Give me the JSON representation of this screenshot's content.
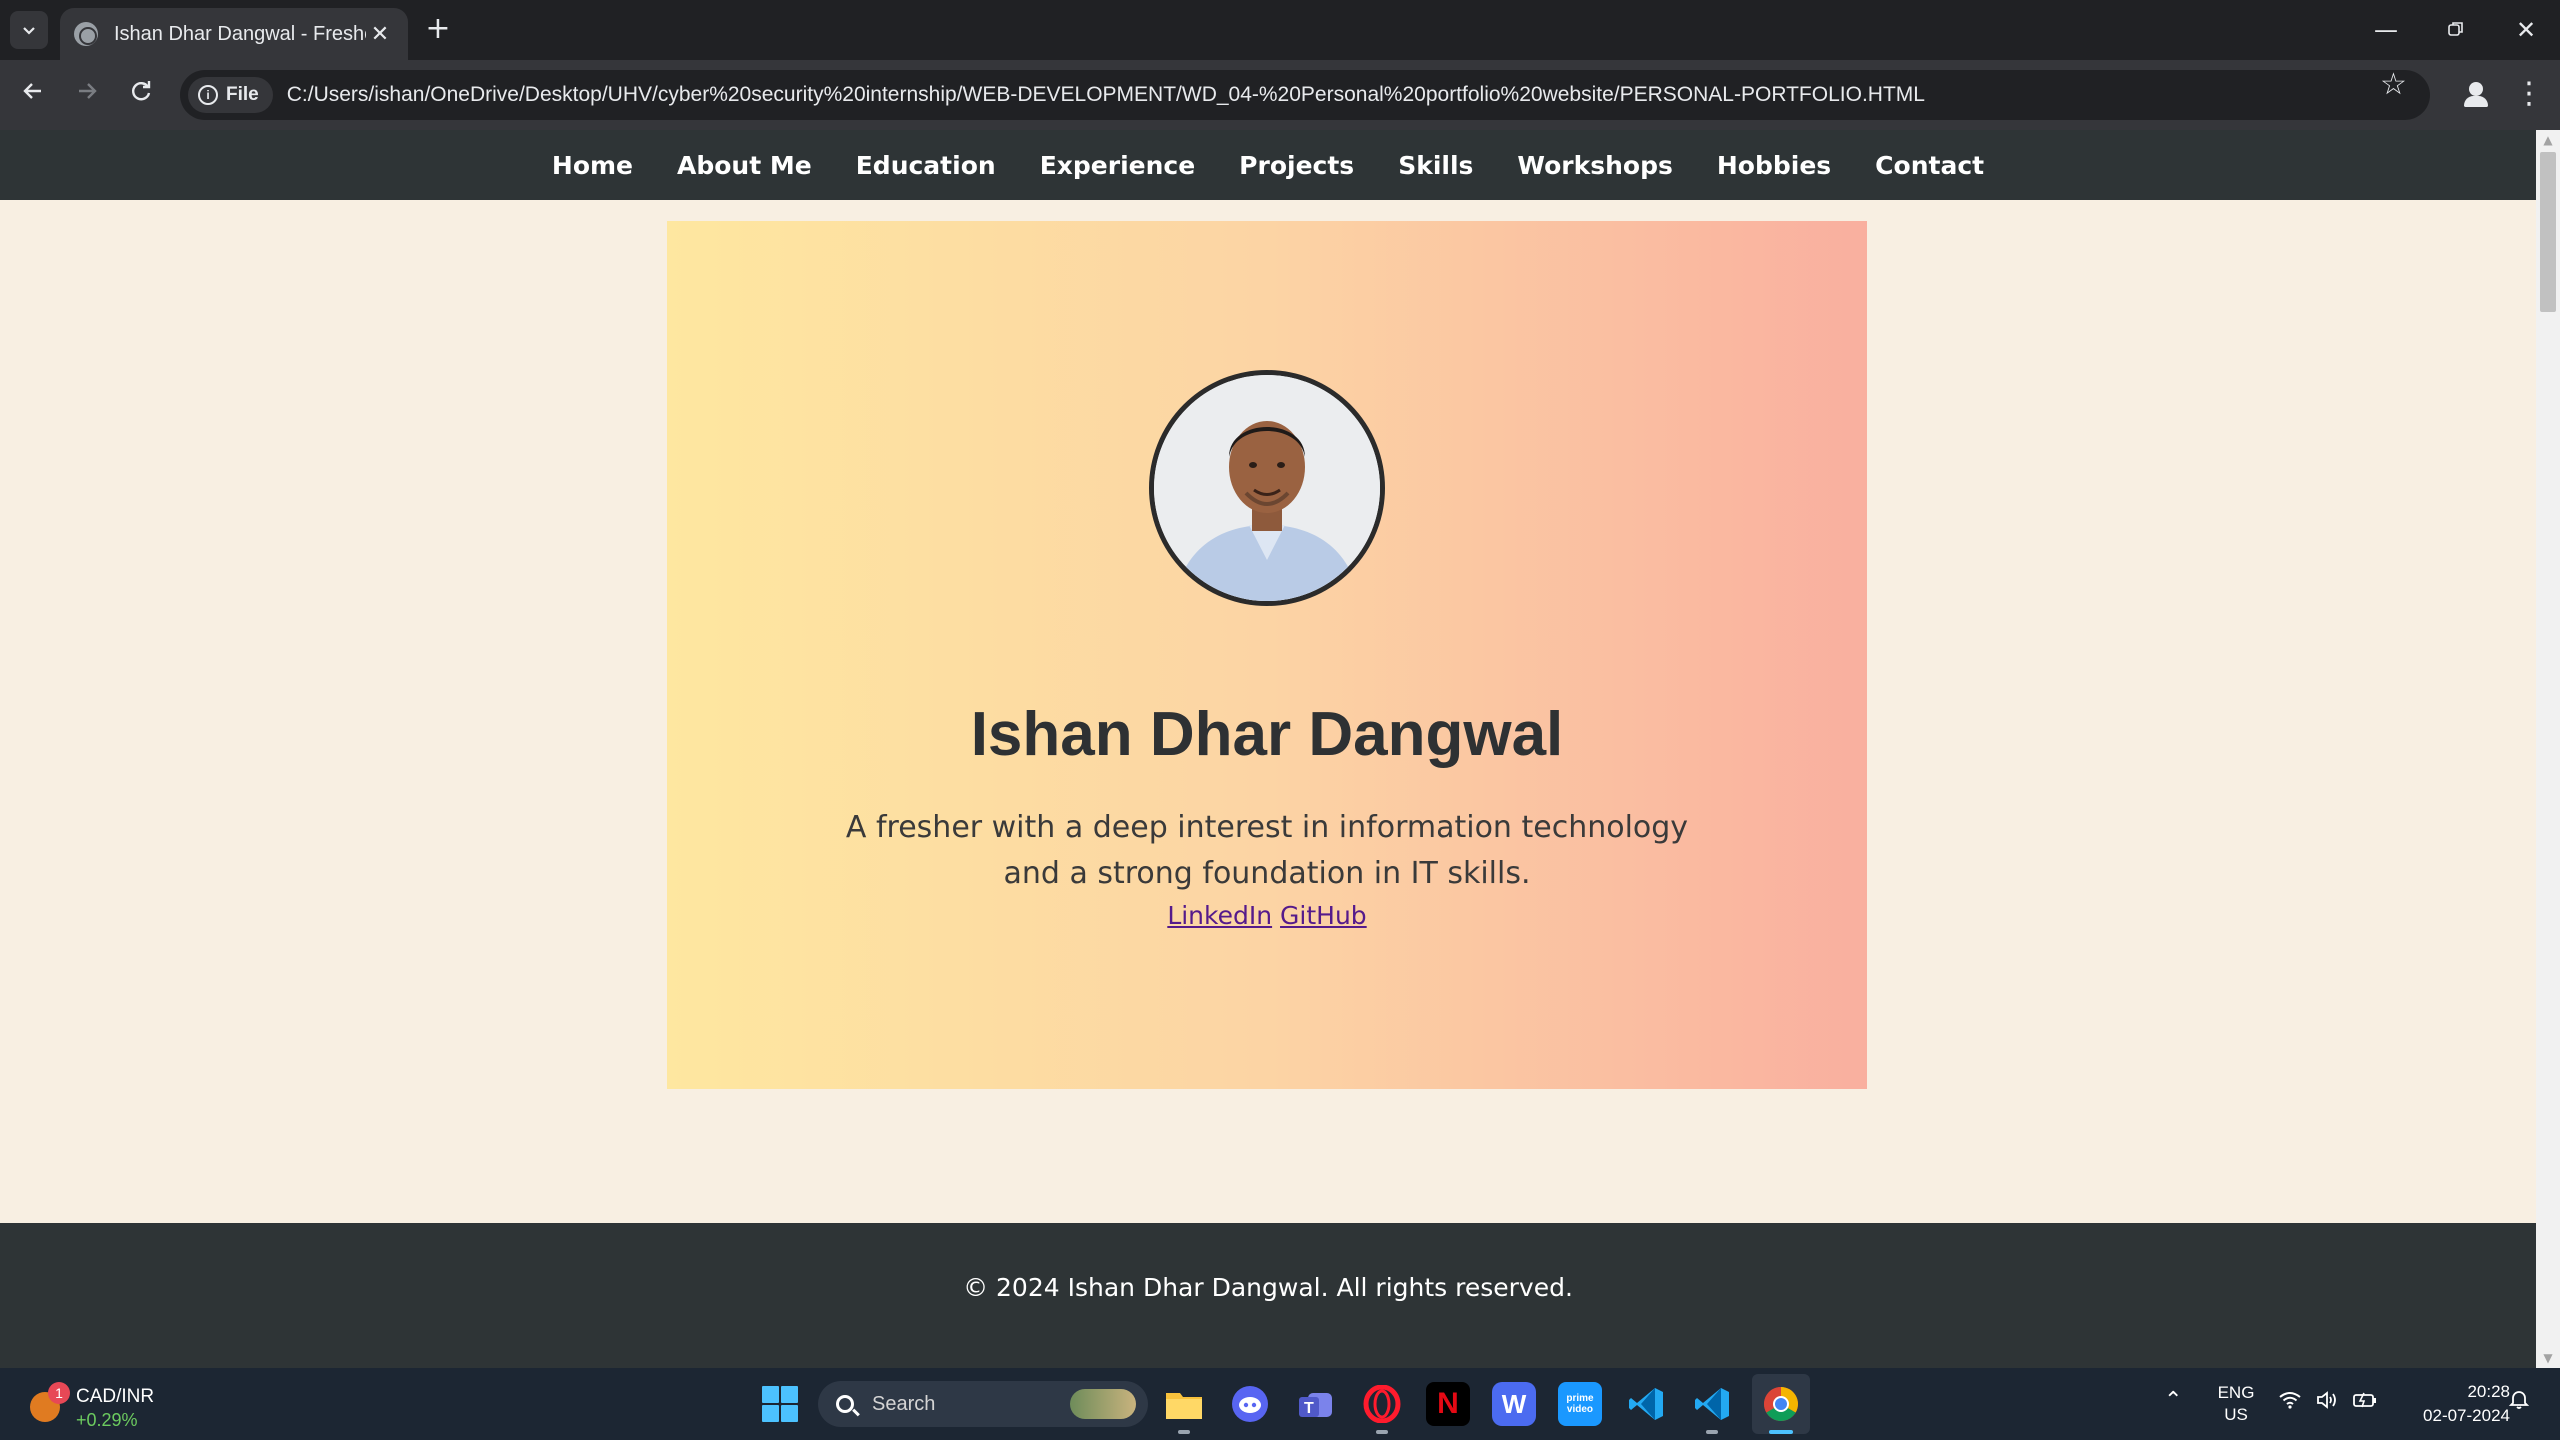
{
  "browser": {
    "tab_title": "Ishan Dhar Dangwal - Fresher",
    "site_chip": "File",
    "url": "C:/Users/ishan/OneDrive/Desktop/UHV/cyber%20security%20internship/WEB-DEVELOPMENT/WD_04-%20Personal%20portfolio%20website/PERSONAL-PORTFOLIO.HTML",
    "icons": [
      "tab-search-icon",
      "globe-icon",
      "close-icon",
      "plus-icon",
      "minimize-icon",
      "restore-icon",
      "back-icon",
      "forward-icon",
      "reload-icon",
      "info-icon",
      "star-icon",
      "profile-icon",
      "menu-icon"
    ]
  },
  "page": {
    "nav": [
      "Home",
      "About Me",
      "Education",
      "Experience",
      "Projects",
      "Skills",
      "Workshops",
      "Hobbies",
      "Contact"
    ],
    "hero": {
      "name": "Ishan Dhar Dangwal",
      "tagline": "A fresher with a deep interest in information technology and a strong foundation in IT skills.",
      "links": [
        "LinkedIn",
        "GitHub"
      ]
    },
    "footer": "© 2024 Ishan Dhar Dangwal. All rights reserved."
  },
  "taskbar": {
    "widget": {
      "title": "CAD/INR",
      "value": "+0.29%",
      "badge": "1"
    },
    "search_label": "Search",
    "apps": [
      "file-explorer",
      "discord",
      "teams",
      "opera",
      "netflix",
      "webtoon",
      "prime-video",
      "vscode",
      "vscode",
      "chrome"
    ],
    "language": [
      "ENG",
      "US"
    ],
    "time": "20:28",
    "date": "02-07-2024"
  },
  "colors": {
    "nav_bg": "#2e3436",
    "page_bg": "#f8efe2",
    "hero_gradient_start": "#fee7a0",
    "hero_gradient_end": "#f9af9f",
    "link": "#551a8b"
  }
}
